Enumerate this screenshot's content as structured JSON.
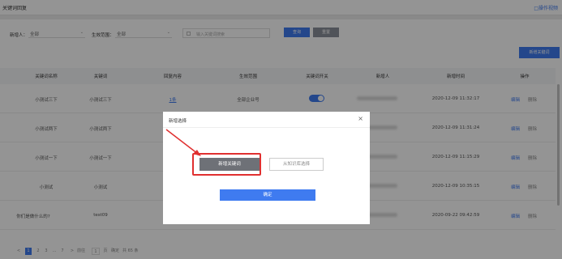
{
  "header": {
    "title": "关键词回复",
    "help_link": "□操作视频"
  },
  "filters": {
    "creator_label": "新增人：",
    "creator_value": "全部",
    "scope_label": "生效范围：",
    "scope_value": "全部",
    "keyword_placeholder": "输入关键词搜索",
    "search_button": "查询",
    "reset_button": "重置",
    "add_button": "新增关键词"
  },
  "table": {
    "columns": [
      "关键词名称",
      "关键词",
      "回复内容",
      "生效范围",
      "关键词开关",
      "新增人",
      "新增时间",
      "操作"
    ],
    "rows": [
      {
        "name": "小测试三下",
        "keyword": "小测试三下",
        "reply": "1条",
        "scope": "全部企业号",
        "switch": true,
        "time": "2020-12-09 11:32:17",
        "edit": "编辑",
        "delete": "删除"
      },
      {
        "name": "小测试两下",
        "keyword": "小测试两下",
        "reply": "",
        "scope": "",
        "switch": false,
        "time": "2020-12-09 11:31:24",
        "edit": "编辑",
        "delete": "删除"
      },
      {
        "name": "小测试一下",
        "keyword": "小测试一下",
        "reply": "",
        "scope": "",
        "switch": false,
        "time": "2020-12-09 11:15:29",
        "edit": "编辑",
        "delete": "删除"
      },
      {
        "name": "小测试",
        "keyword": "小测试",
        "reply": "",
        "scope": "",
        "switch": false,
        "time": "2020-12-09 10:35:15",
        "edit": "编辑",
        "delete": "删除"
      },
      {
        "name": "你们是做什么的?",
        "keyword": "test09",
        "reply": "",
        "scope": "",
        "switch": false,
        "time": "2020-09-22 09:42:59",
        "edit": "编辑",
        "delete": "删除"
      }
    ]
  },
  "pagination": {
    "prev": "<",
    "pages": [
      "1",
      "2",
      "3",
      "...",
      "7"
    ],
    "next": ">",
    "goto_label": "前往",
    "goto_value": "1",
    "page_unit": "页",
    "confirm": "确定",
    "total": "共 65 条"
  },
  "modal": {
    "title": "新增选择",
    "close": "×",
    "option_new": "新增关键词",
    "option_library": "从知识库选择",
    "confirm": "确定"
  },
  "colors": {
    "accent": "#3f7bf0",
    "highlight": "#e03030"
  }
}
